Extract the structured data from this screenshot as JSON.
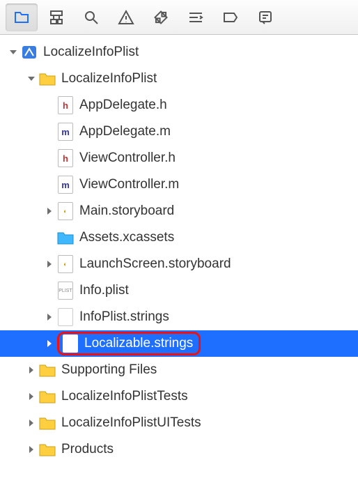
{
  "toolbar": {
    "items": [
      "folder",
      "structure",
      "search",
      "warning",
      "result",
      "editor",
      "tag",
      "comment"
    ],
    "active_index": 0
  },
  "tree": {
    "root": {
      "name": "LocalizeInfoPlist",
      "icon": "xcodeproj",
      "expanded": true,
      "children": [
        {
          "name": "LocalizeInfoPlist",
          "icon": "folder",
          "expanded": true,
          "children": [
            {
              "name": "AppDelegate.h",
              "icon": "h"
            },
            {
              "name": "AppDelegate.m",
              "icon": "m"
            },
            {
              "name": "ViewController.h",
              "icon": "h"
            },
            {
              "name": "ViewController.m",
              "icon": "m"
            },
            {
              "name": "Main.storyboard",
              "icon": "storyboard",
              "expandable": true
            },
            {
              "name": "Assets.xcassets",
              "icon": "xcassets"
            },
            {
              "name": "LaunchScreen.storyboard",
              "icon": "storyboard",
              "expandable": true
            },
            {
              "name": "Info.plist",
              "icon": "plist"
            },
            {
              "name": "InfoPlist.strings",
              "icon": "strings",
              "expandable": true
            },
            {
              "name": "Localizable.strings",
              "icon": "strings",
              "expandable": true,
              "selected": true,
              "highlighted": true
            }
          ]
        },
        {
          "name": "Supporting Files",
          "icon": "folder",
          "expandable": true
        },
        {
          "name": "LocalizeInfoPlistTests",
          "icon": "folder",
          "expandable": true
        },
        {
          "name": "LocalizeInfoPlistUITests",
          "icon": "folder",
          "expandable": true
        },
        {
          "name": "Products",
          "icon": "folder",
          "expandable": true
        }
      ]
    }
  }
}
